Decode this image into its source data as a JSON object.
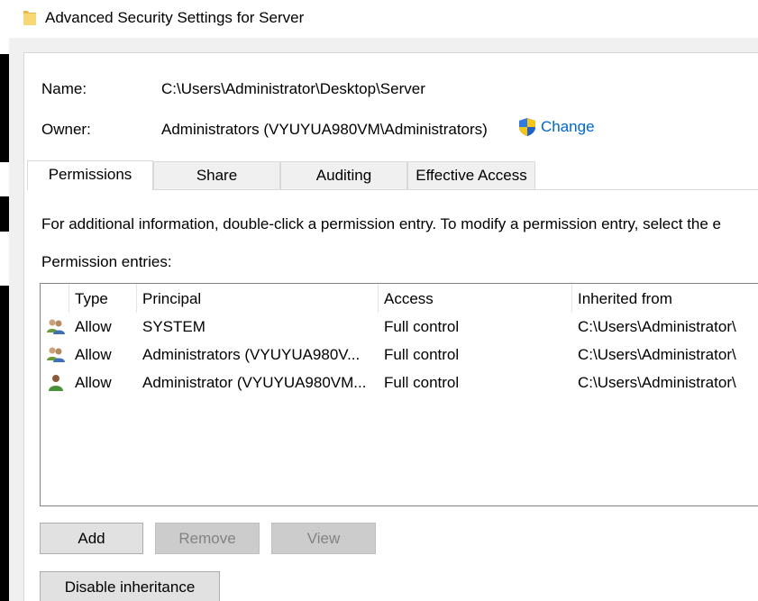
{
  "window": {
    "title": "Advanced Security Settings for Server"
  },
  "info": {
    "name_label": "Name:",
    "name_value": "C:\\Users\\Administrator\\Desktop\\Server",
    "owner_label": "Owner:",
    "owner_value": "Administrators (VYUYUA980VM\\Administrators)",
    "change_label": "Change"
  },
  "tabs": [
    {
      "label": "Permissions",
      "active": true
    },
    {
      "label": "Share",
      "active": false
    },
    {
      "label": "Auditing",
      "active": false
    },
    {
      "label": "Effective Access",
      "active": false
    }
  ],
  "instructions": "For additional information, double-click a permission entry. To modify a permission entry, select the e",
  "entries_label": "Permission entries:",
  "columns": {
    "type": "Type",
    "principal": "Principal",
    "access": "Access",
    "inherited": "Inherited from"
  },
  "entries": [
    {
      "icon": "group-users-icon",
      "type": "Allow",
      "principal": "SYSTEM",
      "access": "Full control",
      "inherited": "C:\\Users\\Administrator\\"
    },
    {
      "icon": "group-users-icon",
      "type": "Allow",
      "principal": "Administrators (VYUYUA980V...",
      "access": "Full control",
      "inherited": "C:\\Users\\Administrator\\"
    },
    {
      "icon": "user-icon",
      "type": "Allow",
      "principal": "Administrator (VYUYUA980VM...",
      "access": "Full control",
      "inherited": "C:\\Users\\Administrator\\"
    }
  ],
  "buttons": {
    "add": "Add",
    "remove": "Remove",
    "view": "View",
    "disable_inheritance": "Disable inheritance"
  },
  "colors": {
    "link": "#0066cc",
    "panel": "#ffffff",
    "chrome": "#f0f0f0"
  }
}
